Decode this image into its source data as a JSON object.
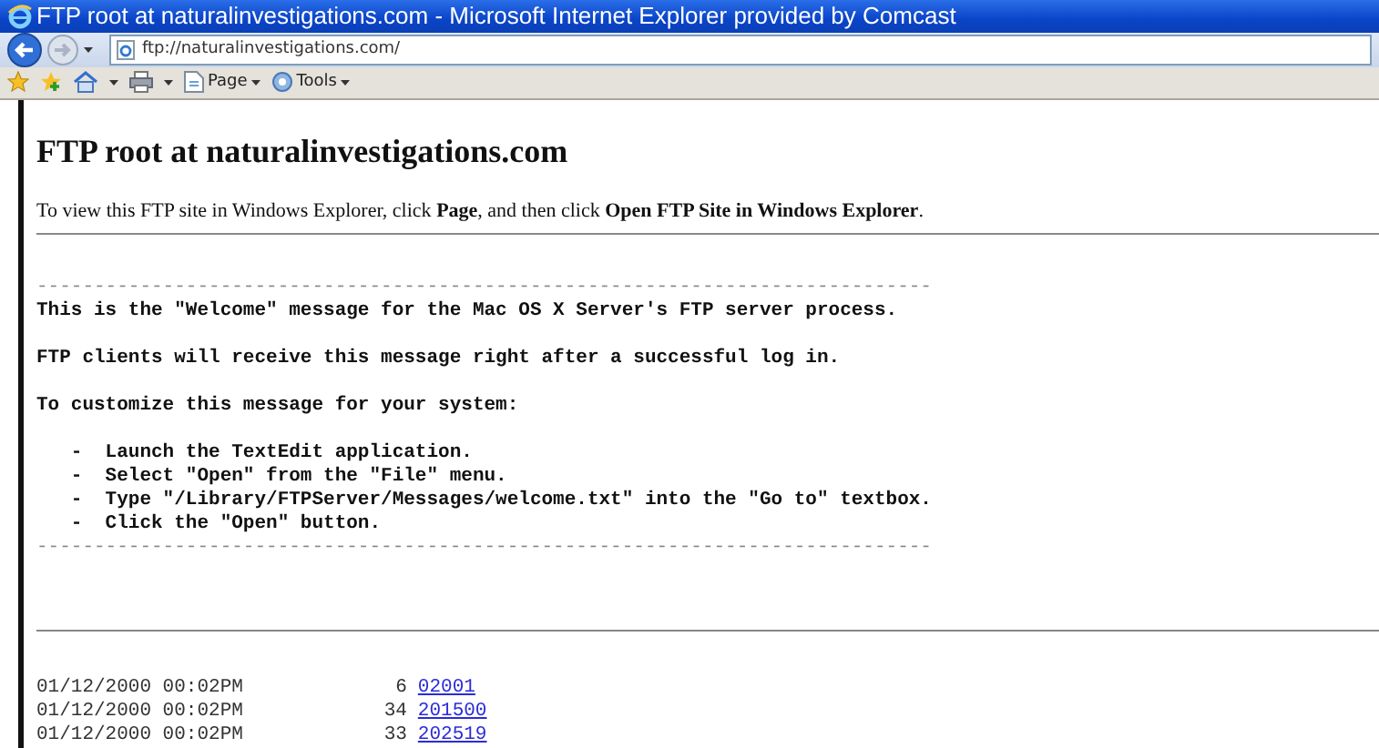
{
  "window": {
    "title": "FTP root at naturalinvestigations.com - Microsoft Internet Explorer provided by Comcast"
  },
  "address_bar": {
    "url": "ftp://naturalinvestigations.com/"
  },
  "toolbar": {
    "items": [
      {
        "label": "Page"
      },
      {
        "label": "Tools"
      }
    ]
  },
  "page": {
    "heading": "FTP root at naturalinvestigations.com",
    "intro": "To view this FTP site in Windows Explorer, click **Page**, and then click **Open FTP Site in Windows Explorer**.",
    "message": [
      {
        "kind": "rule",
        "text": "------------------------------------------------------------------------------"
      },
      {
        "kind": "line",
        "text": "This is the \"Welcome\" message for the Mac OS X Server's FTP server process."
      },
      {
        "kind": "gap"
      },
      {
        "kind": "line",
        "text": "FTP clients will receive this message right after a successful log in."
      },
      {
        "kind": "gap"
      },
      {
        "kind": "line",
        "text": "To customize this message for your system:"
      },
      {
        "kind": "gap"
      },
      {
        "kind": "line",
        "text": "   -  Launch the TextEdit application."
      },
      {
        "kind": "line",
        "text": "   -  Select \"Open\" from the \"File\" menu."
      },
      {
        "kind": "line",
        "text": "   -  Type \"/Library/FTPServer/Messages/welcome.txt\" into the \"Go to\" textbox."
      },
      {
        "kind": "line",
        "text": "   -  Click the \"Open\" button."
      },
      {
        "kind": "rule",
        "text": "------------------------------------------------------------------------------"
      }
    ],
    "listing": [
      {
        "date": "01/12/2000 00:02PM",
        "size": "6",
        "name": "02001"
      },
      {
        "date": "01/12/2000 00:02PM",
        "size": "34",
        "name": "201500"
      },
      {
        "date": "01/12/2000 00:02PM",
        "size": "33",
        "name": "202519"
      }
    ]
  }
}
